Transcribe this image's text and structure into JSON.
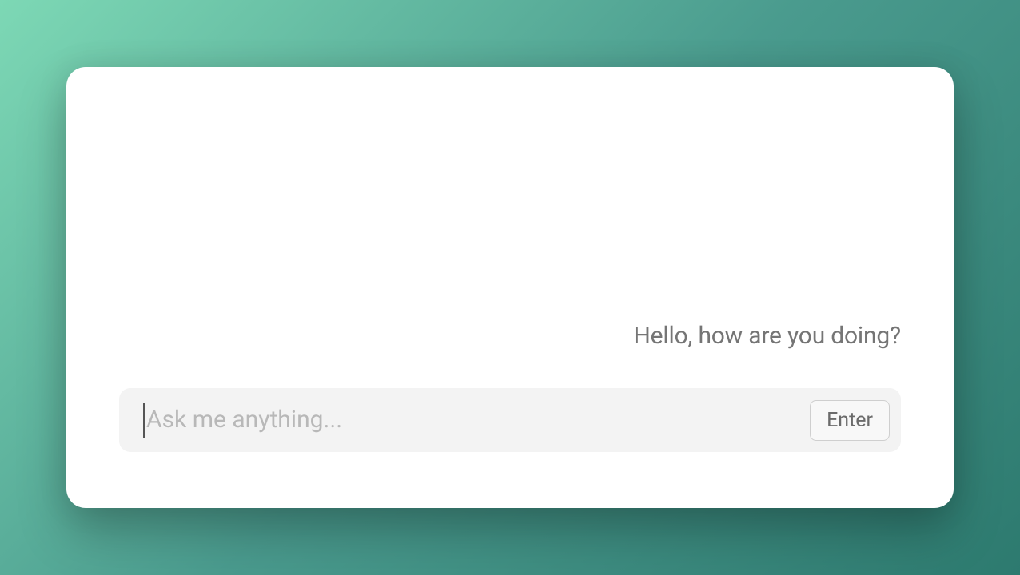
{
  "chat": {
    "messages": [
      {
        "role": "user",
        "text": "Hello, how are you doing?"
      }
    ]
  },
  "input": {
    "placeholder": "Ask me anything...",
    "value": ""
  },
  "buttons": {
    "enter_label": "Enter"
  }
}
